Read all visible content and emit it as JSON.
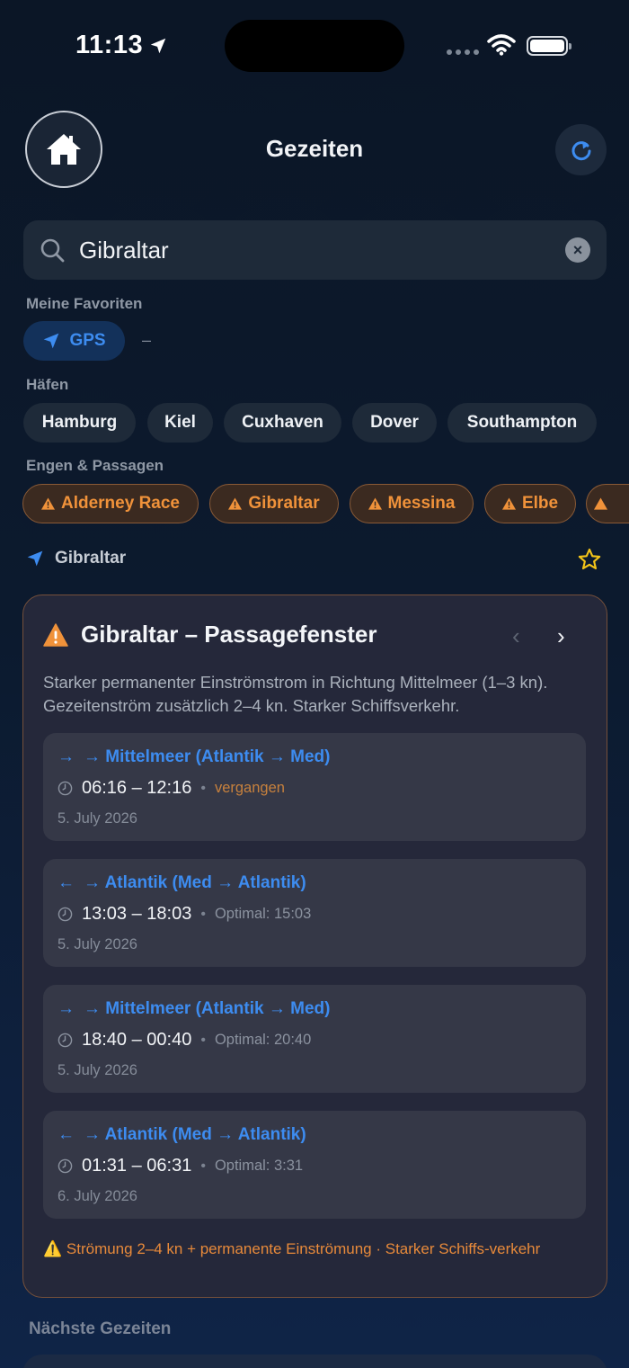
{
  "status": {
    "time": "11:13"
  },
  "header": {
    "title": "Gezeiten"
  },
  "search": {
    "value": "Gibraltar",
    "clear_label": "×"
  },
  "favorites": {
    "label": "Meine Favoriten",
    "gps_label": "GPS",
    "empty_marker": "–"
  },
  "ports": {
    "label": "Häfen",
    "items": [
      "Hamburg",
      "Kiel",
      "Cuxhaven",
      "Dover",
      "Southampton"
    ]
  },
  "straits": {
    "label": "Engen & Passagen",
    "items": [
      "Alderney Race",
      "Gibraltar",
      "Messina",
      "Elbe"
    ]
  },
  "location": {
    "name": "Gibraltar"
  },
  "card": {
    "title": "Gibraltar – Passagefenster",
    "nav_prev": "‹",
    "nav_next": "›",
    "description": "Starker permanenter Einströmstrom in Richtung Mittelmeer (1–3 kn). Gezeitenström zusätzlich 2–4 kn. Starker Schiffsverkehr.",
    "windows": [
      {
        "arrow": "→",
        "direction": "→ Mittelmeer (Atlantik → Med)",
        "range": "06:16 – 12:16",
        "sep": "•",
        "note": "vergangen",
        "date": "5. July 2026"
      },
      {
        "arrow": "←",
        "direction": "→ Atlantik (Med → Atlantik)",
        "range": "13:03 – 18:03",
        "sep": "•",
        "note": "Optimal: 15:03",
        "date": "5. July 2026"
      },
      {
        "arrow": "→",
        "direction": "→ Mittelmeer (Atlantik → Med)",
        "range": "18:40 – 00:40",
        "sep": "•",
        "note": "Optimal: 20:40",
        "date": "5. July 2026"
      },
      {
        "arrow": "←",
        "direction": "→ Atlantik (Med → Atlantik)",
        "range": "01:31 – 06:31",
        "sep": "•",
        "note": "Optimal: 3:31",
        "date": "6. July 2026"
      }
    ],
    "warning": "⚠️ Strömung 2–4 kn + permanente Einströmung · Starker Schiffs-verkehr"
  },
  "next_tides": {
    "label": "Nächste Gezeiten"
  },
  "colors": {
    "accent": "#3d8cf0",
    "warning": "#f0923a",
    "star": "#f5c518"
  }
}
